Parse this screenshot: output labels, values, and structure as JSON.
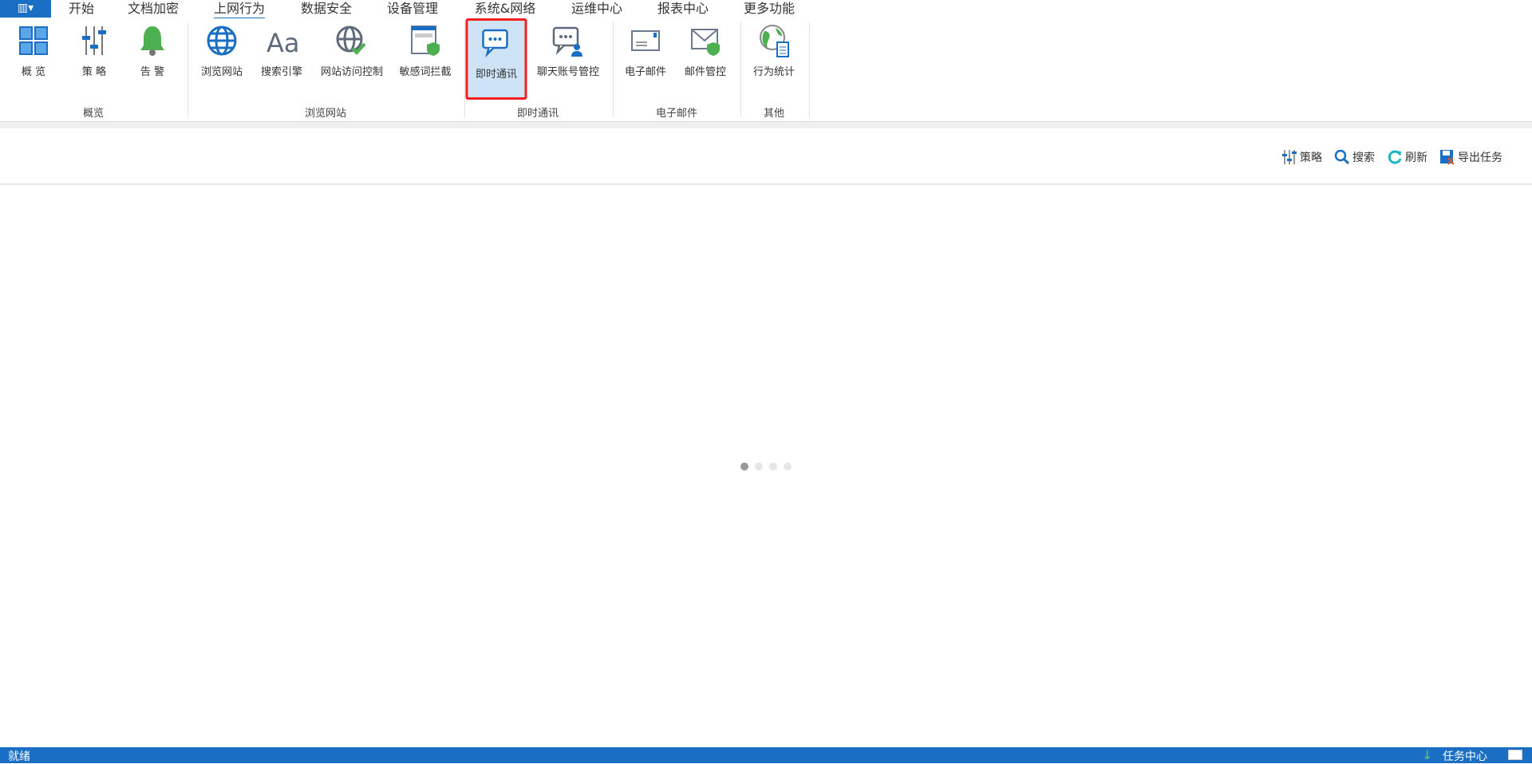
{
  "menu": {
    "tabs": [
      "开始",
      "文档加密",
      "上网行为",
      "数据安全",
      "设备管理",
      "系统&网络",
      "运维中心",
      "报表中心",
      "更多功能"
    ],
    "active": "上网行为"
  },
  "ribbon": {
    "groups": [
      "概览",
      "浏览网站",
      "即时通讯",
      "电子邮件",
      "其他"
    ],
    "buttons": [
      "概 览",
      "策 略",
      "告 警",
      "浏览网站",
      "搜索引擎",
      "网站访问控制",
      "敏感词拦截",
      "即时通讯",
      "聊天账号管控",
      "电子邮件",
      "邮件管控",
      "行为统计"
    ],
    "selected": "即时通讯"
  },
  "toolbar": {
    "policy": "策略",
    "search": "搜索",
    "refresh": "刷新",
    "export": "导出任务"
  },
  "status": {
    "text": "就绪",
    "task_center": "任务中心"
  },
  "colors": {
    "accent": "#1a6fc4",
    "highlight": "#f42020"
  }
}
